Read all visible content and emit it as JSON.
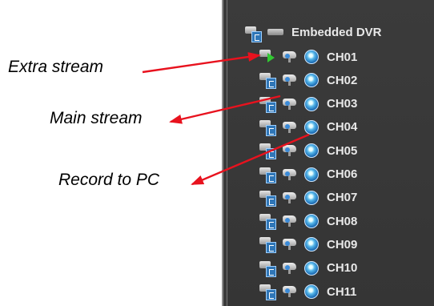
{
  "annotations": {
    "extra_stream": "Extra stream",
    "main_stream": "Main stream",
    "record_to_pc": "Record to PC"
  },
  "tree": {
    "root_label": "Embedded DVR",
    "channels": [
      "CH01",
      "CH02",
      "CH03",
      "CH04",
      "CH05",
      "CH06",
      "CH07",
      "CH08",
      "CH09",
      "CH10",
      "CH11"
    ]
  },
  "colors": {
    "arrow": "#e8121e",
    "panel_bg": "#3a3a3a",
    "text": "#e8e8e8"
  },
  "icons": {
    "extra_stream": "extra-stream-icon",
    "main_stream": "main-stream-icon",
    "record": "record-icon"
  }
}
